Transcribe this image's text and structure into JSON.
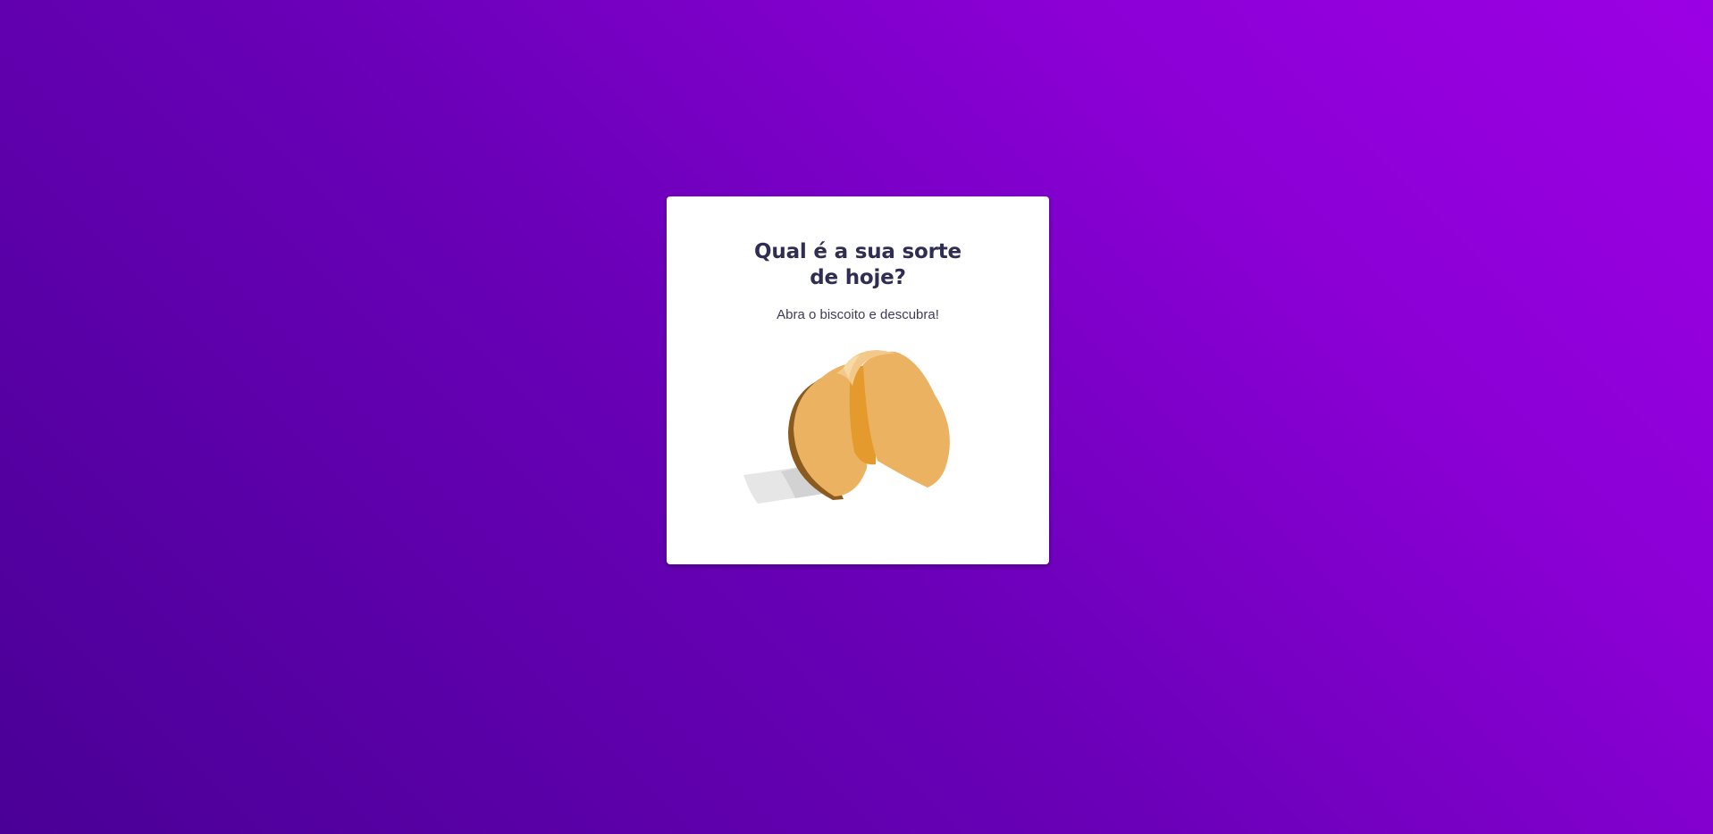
{
  "card": {
    "title": "Qual é a sua sorte de hoje?",
    "subtitle": "Abra o biscoito e descubra!",
    "illustration": "fortune-cookie-icon"
  },
  "colors": {
    "background_start": "#4a0096",
    "background_end": "#9b00e4",
    "title": "#2f2e52",
    "cookie": "#ebb262",
    "cookie_shadow": "#e59a2e",
    "paper": "#e6e6e6"
  }
}
